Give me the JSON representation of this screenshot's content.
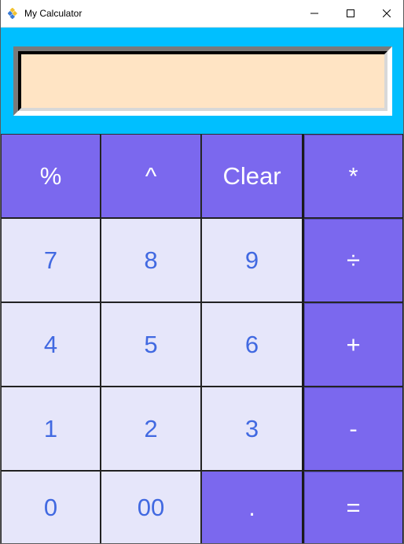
{
  "window": {
    "title": "My Calculator",
    "icon": "python-diamond-icon",
    "controls": {
      "minimize": "minimize-icon",
      "maximize": "maximize-icon",
      "close": "close-icon"
    }
  },
  "display": {
    "value": ""
  },
  "colors": {
    "background": "#00bfff",
    "display_bg": "#ffe4c4",
    "digit_key_bg": "#e6e6fa",
    "digit_key_text": "#4169e1",
    "operator_key_bg": "#7b68ee",
    "operator_key_text": "#ffffff"
  },
  "keys": {
    "percent": "%",
    "power": "^",
    "clear": "Clear",
    "multiply": "*",
    "seven": "7",
    "eight": "8",
    "nine": "9",
    "divide": "÷",
    "four": "4",
    "five": "5",
    "six": "6",
    "add": "+",
    "one": "1",
    "two": "2",
    "three": "3",
    "subtract": "-",
    "zero": "0",
    "double_zero": "00",
    "decimal": ".",
    "equals": "="
  }
}
